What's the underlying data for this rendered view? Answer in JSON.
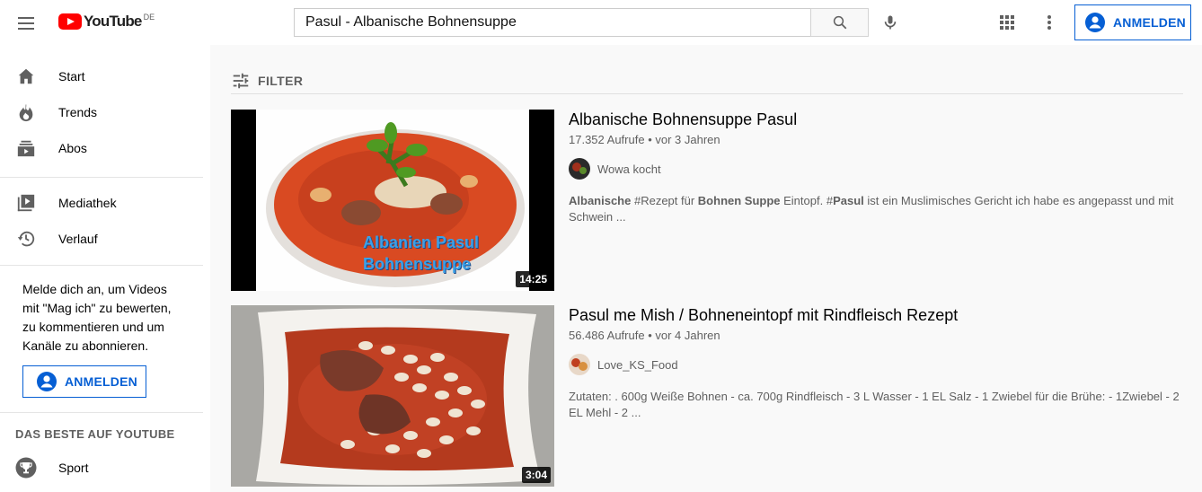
{
  "header": {
    "logo_text": "YouTube",
    "country_code": "DE",
    "search_query": "Pasul - Albanische Bohnensuppe",
    "signin_label": "ANMELDEN"
  },
  "sidebar": {
    "items": [
      {
        "label": "Start",
        "icon": "home-icon"
      },
      {
        "label": "Trends",
        "icon": "fire-icon"
      },
      {
        "label": "Abos",
        "icon": "subscriptions-icon"
      },
      {
        "label": "Mediathek",
        "icon": "library-icon"
      },
      {
        "label": "Verlauf",
        "icon": "history-icon"
      }
    ],
    "signin_prompt": "Melde dich an, um Videos mit \"Mag ich\" zu bewerten, zu kommentieren und um Kanäle zu abonnieren.",
    "signin_label": "ANMELDEN",
    "section_title": "DAS BESTE AUF YOUTUBE",
    "best_items": [
      {
        "label": "Sport",
        "icon": "trophy-icon"
      }
    ]
  },
  "filter": {
    "label": "FILTER"
  },
  "results": [
    {
      "title": "Albanische Bohnensuppe Pasul",
      "views": "17.352 Aufrufe",
      "age": "vor 3 Jahren",
      "channel": "Wowa kocht",
      "duration": "14:25",
      "thumb_overlay_line1": "Albanien Pasul",
      "thumb_overlay_line2": "Bohnensuppe",
      "desc_parts": [
        {
          "text": "Albanische",
          "bold": true
        },
        {
          "text": " #Rezept für ",
          "bold": false
        },
        {
          "text": "Bohnen Suppe",
          "bold": true
        },
        {
          "text": " Eintopf. #",
          "bold": false
        },
        {
          "text": "Pasul",
          "bold": true
        },
        {
          "text": " ist ein Muslimisches Gericht ich habe es angepasst und mit Schwein ...",
          "bold": false
        }
      ]
    },
    {
      "title": "Pasul me Mish / Bohneneintopf mit Rindfleisch Rezept",
      "views": "56.486 Aufrufe",
      "age": "vor 4 Jahren",
      "channel": "Love_KS_Food",
      "duration": "3:04",
      "desc_parts": [
        {
          "text": "Zutaten: . 600g Weiße Bohnen - ca. 700g Rindfleisch - 3 L Wasser - 1 EL Salz - 1 Zwiebel für die Brühe: - 1Zwiebel - 2 EL Mehl - 2 ...",
          "bold": false
        }
      ]
    }
  ],
  "colors": {
    "brand_red": "#ff0000",
    "link_blue": "#065fd4",
    "secondary_text": "#606060"
  }
}
